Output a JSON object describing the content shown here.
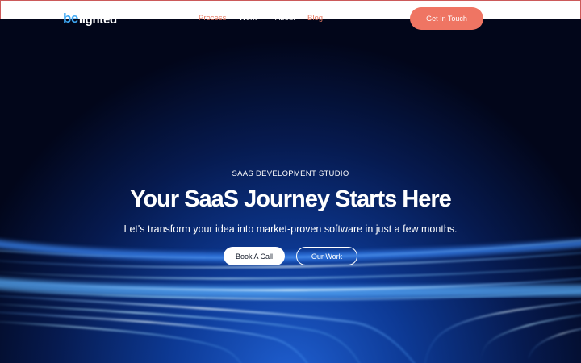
{
  "brand": {
    "logo_prefix": "be",
    "logo_suffix": "lighted",
    "accent_color": "#ef7563",
    "logo_color": "#3fa9f5"
  },
  "nav": {
    "links": [
      "Process",
      "Work",
      "About",
      "Blog"
    ],
    "cta_label": "Get In Touch",
    "menu_label": "Menu"
  },
  "hero": {
    "eyebrow": "SAAS DEVELOPMENT STUDIO",
    "headline": "Your SaaS Journey Starts Here",
    "subhead": "Let's transform your idea into market-proven software in just a few months.",
    "primary_button": "Book A Call",
    "secondary_button": "Our Work"
  },
  "icons": {
    "menu": "hamburger-icon"
  }
}
